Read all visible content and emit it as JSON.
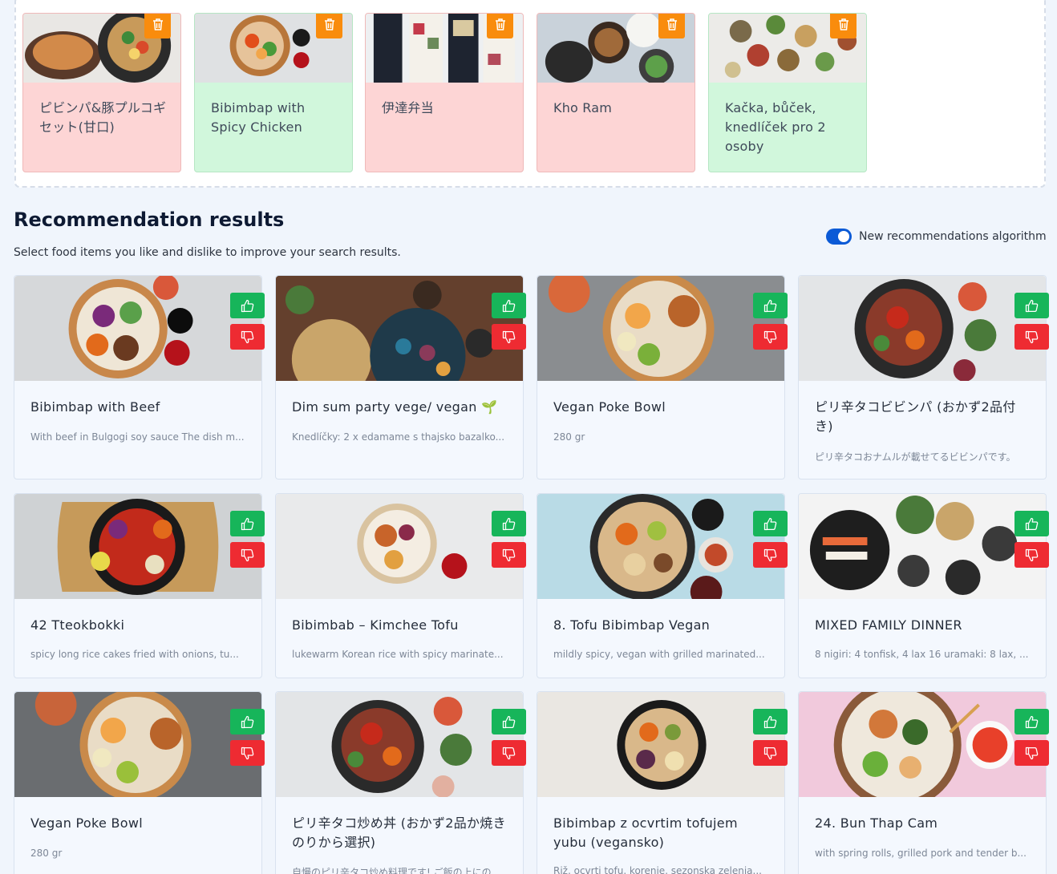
{
  "selected": [
    {
      "name": "ピビンパ&豚プルコギセット(甘口)",
      "state": "disliked",
      "image": "bibimbap-bulgogi-photo"
    },
    {
      "name": "Bibimbap with Spicy Chicken",
      "state": "liked",
      "image": "spicy-chicken-bibimbap-photo"
    },
    {
      "name": "伊達弁当",
      "state": "disliked",
      "image": "bento-photo"
    },
    {
      "name": "Kho Ram",
      "state": "disliked",
      "image": "kho-ram-photo"
    },
    {
      "name": "Kačka, bůček, knedlíček pro 2 osoby",
      "state": "liked",
      "image": "duck-dinner-photo"
    }
  ],
  "recommendations": {
    "title": "Recommendation results",
    "subtitle": "Select food items you like and dislike to improve your search results.",
    "toggle_label": "New recommendations algorithm",
    "toggle_on": true
  },
  "results": [
    {
      "name": "Bibimbap with Beef",
      "desc": "With beef in Bulgogi soy sauce The dish m..."
    },
    {
      "name": "Dim sum party vege/ vegan 🌱",
      "desc": "Knedlíčky: 2 x edamame s thajsko bazalko..."
    },
    {
      "name": "Vegan Poke Bowl",
      "desc": "280 gr"
    },
    {
      "name": "ピリ辛タコビビンパ (おかず2品付き)",
      "desc": "ピリ辛タコおナムルが載せてるビビンパです。"
    },
    {
      "name": "42 Tteokbokki",
      "desc": "spicy long rice cakes fried with onions, tu..."
    },
    {
      "name": "Bibimbab – Kimchee Tofu",
      "desc": "lukewarm Korean rice with spicy marinate..."
    },
    {
      "name": "8. Tofu Bibimbap Vegan",
      "desc": "mildly spicy, vegan with grilled marinated..."
    },
    {
      "name": "MIXED FAMILY DINNER",
      "desc": "8 nigiri: 4 tonfisk, 4 lax 16 uramaki: 8 lax, ..."
    },
    {
      "name": "Vegan Poke Bowl",
      "desc": "280 gr"
    },
    {
      "name": "ピリ辛タコ炒め丼 (おかず2品か焼きのりから選択)",
      "desc": "自慢のピリ辛タコ炒め料理です! ご飯の上にの..."
    },
    {
      "name": "Bibimbap z ocvrtim tofujem yubu (vegansko)",
      "desc": "Riž, ocvrti tofu, korenje, sezonska zelenja..."
    },
    {
      "name": "24. Bun Thap Cam",
      "desc": "with spring rolls, grilled pork and tender b..."
    }
  ],
  "colors": {
    "like": "#17b55a",
    "dislike": "#ee2b32",
    "delete": "#f98c0d",
    "liked_bg": "#d1f7dc",
    "disliked_bg": "#fdd5d5",
    "toggle": "#0b5ad6"
  },
  "icons": {
    "delete": "trash-icon",
    "like": "thumbs-up-icon",
    "dislike": "thumbs-down-icon"
  }
}
